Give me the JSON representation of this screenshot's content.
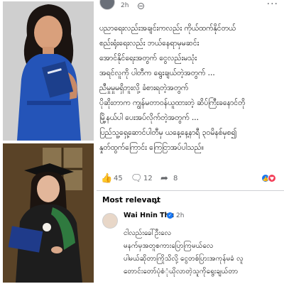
{
  "post": {
    "time": "2h",
    "text_lines": [
      "ပညာရေးလည်းအချင်းကလည်း ကိုယ်ထက်နိုင်တယ်",
      "စည်းရုံးရေးလည်း ဘယ်နေရာမှမဆင်း",
      "အောင်နိုင်ရေးအတွက် ငွေလည်းမသုံး",
      "အရင်လူကို ပါတီက ရွေးချယ်တဲ့အတွက် ...",
      "ညီမှုမှုမရှိဘူးလို့ ခံစားရတဲ့အတွက်",
      "ပိုဆိုးတာက ကျွန်မတာဝန်ယူထားတဲ့ ဆိပ်ကြီးခနောင်တို",
      "မြို့နယ်ပါ ပေးအပ်လိုက်တဲ့အတွက် ...",
      "ပြည်သူ့ရှေ့ဆောင်ပါတီမှ ယနေ့နေ့နာရီ ၃ဝမိနစ်မှစ၍",
      "နှုတ်ထွက်ကြောင်း ကြေငြာအပ်ပါသည်။"
    ],
    "reactions": {
      "likes": "45",
      "comments": "12",
      "shares": "8"
    }
  },
  "comments_filter": "Most relevant",
  "comment": {
    "author": "Wai Hnin Thu",
    "time": "2h",
    "text_lines": [
      "ငါလည်းခေါ်ဦးလေ",
      "မနက်မှအတူစကားပြောကြမယ်လေ",
      "ပါမယ်ဆိုတာကြိုသိလို့ ငွေတစ်ပြားအကုန်မခံ လူ",
      "တောင်းတော်ပုံစံုံယိုလာတဲ့သူကိုရွေးချယ်တာ"
    ]
  },
  "colors": {
    "accent": "#1877f2",
    "love": "#f33e58",
    "muted": "#65676b"
  }
}
